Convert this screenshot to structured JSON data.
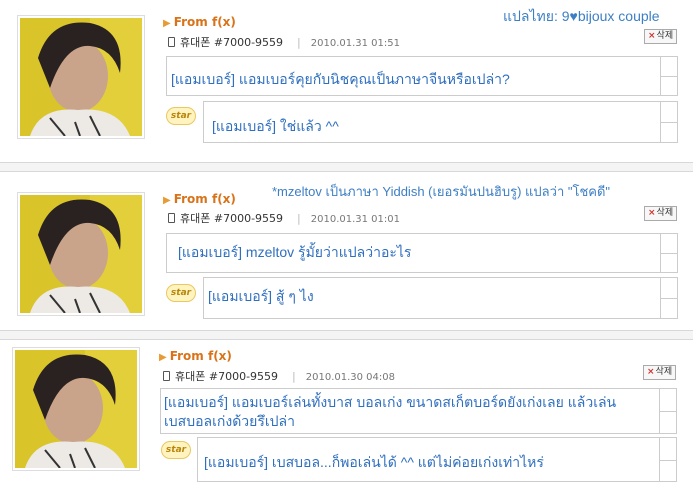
{
  "colors": {
    "from": "#d9731a",
    "comment_text": "#2f6fbf",
    "note_text": "#3d7fc4"
  },
  "posts": [
    {
      "from_label": "From f(x)",
      "phone": "휴대폰 #7000-9559",
      "date": "2010.01.31 01:51",
      "delete_label": "삭제",
      "comment": "[แอมเบอร์] แอมเบอร์คุยกับนิชคุณเป็นภาษาจีนหรือเปล่า?",
      "reply": "[แอมเบอร์] ใช่แล้ว ^^",
      "star_label": "star"
    },
    {
      "from_label": "From f(x)",
      "phone": "휴대폰 #7000-9559",
      "date": "2010.01.31 01:01",
      "delete_label": "삭제",
      "comment": "[แอมเบอร์] mzeltov รู้มั้ยว่าแปลว่าอะไร",
      "reply": "[แอมเบอร์] สู้ ๆ ไง",
      "star_label": "star"
    },
    {
      "from_label": "From f(x)",
      "phone": "휴대폰 #7000-9559",
      "date": "2010.01.30 04:08",
      "delete_label": "삭제",
      "comment": "[แอมเบอร์] แอมเบอร์เล่นทั้งบาส บอลเก่ง ขนาดสเก็ตบอร์ดยังเก่งเลย แล้วเล่นเบสบอลเก่งด้วยรึเปล่า",
      "reply": "[แอมเบอร์] เบสบอล...ก็พอเล่นได้ ^^ แต่ไม่ค่อยเก่งเท่าไหร่",
      "star_label": "star"
    }
  ],
  "credit": "แปลไทย: 9♥bijoux couple",
  "note": "*mzeltov เป็นภาษา Yiddish (เยอรมันปนฮิบรู) แปลว่า \"โชคดี\""
}
